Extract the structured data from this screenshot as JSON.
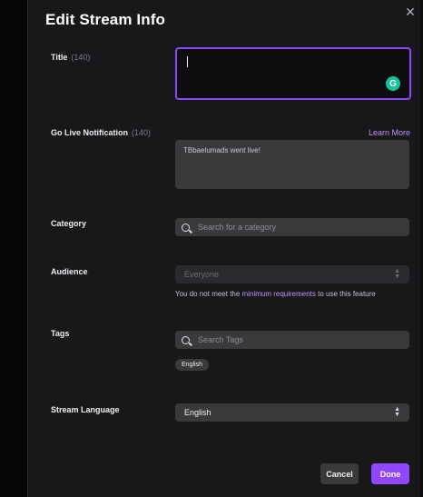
{
  "modal": {
    "title": "Edit Stream Info",
    "close_icon": "close-icon"
  },
  "title_field": {
    "label": "Title",
    "count": "(140)",
    "value": "",
    "grammarly_icon": "grammarly-icon",
    "grammarly_glyph": "G"
  },
  "notification": {
    "label": "Go Live Notification",
    "count": "(140)",
    "learn_more": "Learn More",
    "value": "TBbaelumads went live!"
  },
  "category": {
    "label": "Category",
    "placeholder": "Search for a category",
    "icon": "search-icon"
  },
  "audience": {
    "label": "Audience",
    "value": "Everyone",
    "hint_before": "You do not meet the ",
    "hint_link": "minimum requirements",
    "hint_after": " to use this feature"
  },
  "tags": {
    "label": "Tags",
    "placeholder": "Search Tags",
    "icon": "search-icon",
    "items": [
      "English"
    ]
  },
  "language": {
    "label": "Stream Language",
    "value": "English",
    "icon": "select-arrows-icon"
  },
  "footer": {
    "cancel_label": "Cancel",
    "done_label": "Done"
  },
  "colors": {
    "accent": "#9147ff",
    "link": "#bf94ff",
    "modal_bg": "#18181b",
    "input_bg": "#3a3a3d",
    "grammarly": "#15c39a"
  }
}
